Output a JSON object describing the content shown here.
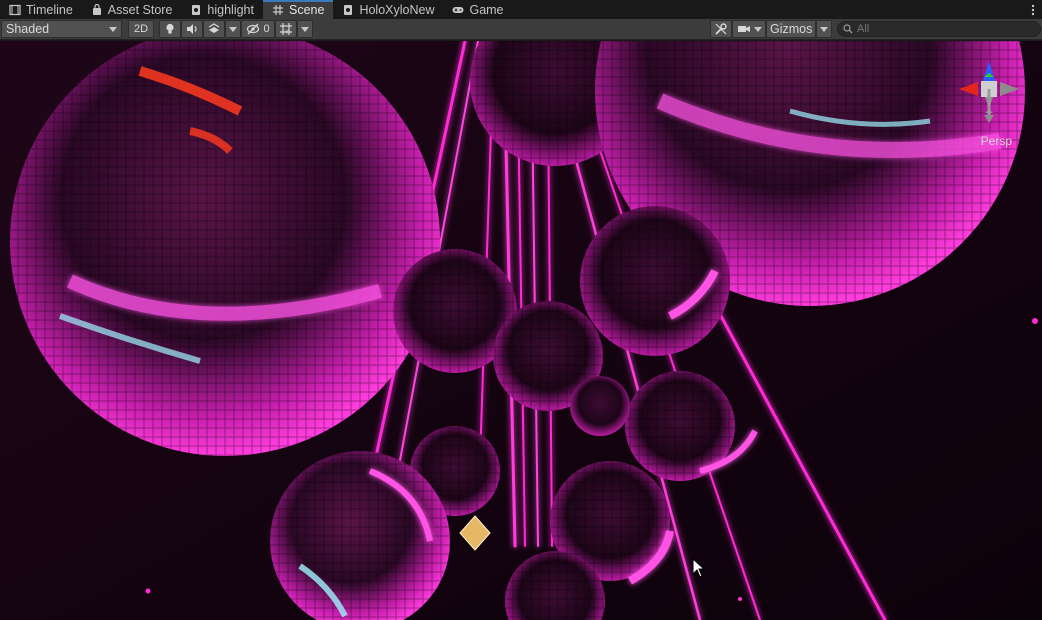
{
  "tabs": [
    {
      "label": "Timeline",
      "icon": "timeline-icon"
    },
    {
      "label": "Asset Store",
      "icon": "bag-icon"
    },
    {
      "label": "highlight",
      "icon": "shader-icon"
    },
    {
      "label": "Scene",
      "icon": "grid-hash-icon",
      "active": true
    },
    {
      "label": "HoloXyloNew",
      "icon": "shader-icon"
    },
    {
      "label": "Game",
      "icon": "gamepad-icon"
    }
  ],
  "toolbar": {
    "draw_mode": "Shaded",
    "toggle_2d": "2D",
    "hidden_count": "0",
    "gizmos_label": "Gizmos",
    "search_placeholder": "All"
  },
  "viewport": {
    "projection_label": "Persp",
    "accent_colors": {
      "tab_highlight": "#3a79bb",
      "neon_pink": "#ff2bd6",
      "neon_magenta": "#d41fc0",
      "background": "#12040f"
    }
  }
}
